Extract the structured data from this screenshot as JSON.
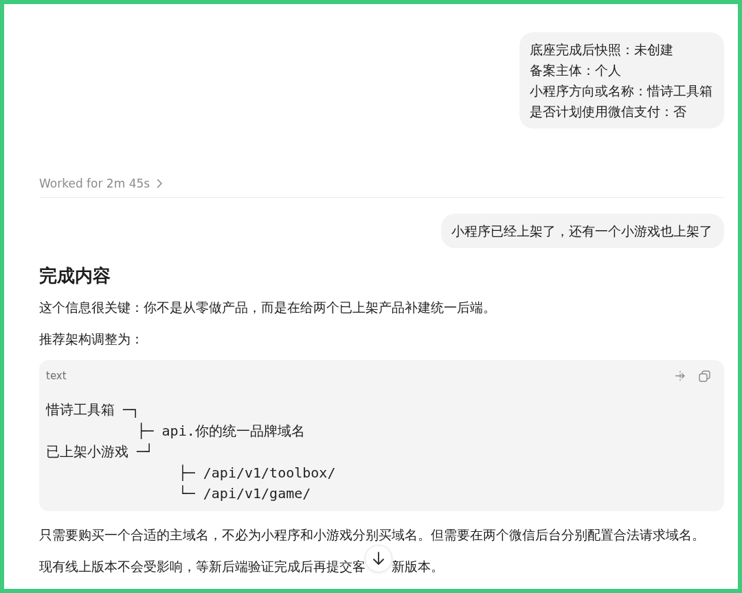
{
  "conversation": [
    {
      "kind": "user_message",
      "lines": [
        "底座完成后快照：未创建",
        "备案主体：个人",
        "小程序方向或名称：惜诗工具箱",
        "是否计划使用微信支付：否"
      ]
    },
    {
      "kind": "work_summary",
      "label": "Worked for 2m 45s"
    },
    {
      "kind": "user_message",
      "lines": [
        "小程序已经上架了，还有一个小游戏也上架了"
      ]
    },
    {
      "kind": "assistant_message",
      "blocks": [
        {
          "kind": "heading",
          "text": "完成内容"
        },
        {
          "kind": "paragraph",
          "parts": [
            "这个信息很关键：你不是从零做产品，而是在给两个已上架产品补建统一后端。"
          ]
        },
        {
          "kind": "paragraph",
          "parts": [
            "推荐架构调整为："
          ]
        },
        {
          "kind": "code",
          "language": "text",
          "lines": [
            "惜诗工具箱 ─┐",
            "           ├─ api.你的统一品牌域名",
            "已上架小游戏 ─┘",
            "                ├─ /api/v1/toolbox/",
            "                └─ /api/v1/game/"
          ]
        },
        {
          "kind": "paragraph",
          "parts": [
            "只需要购买一个合适的主域名，不必为小程序和小游戏分别买域名。但需要在两个微信后台分别配置合法请求域名。"
          ]
        },
        {
          "kind": "paragraph",
          "parts": [
            "现有线上版本不会受影响，等新后端验证完成后再提交客",
            "新版本。"
          ]
        }
      ]
    }
  ]
}
